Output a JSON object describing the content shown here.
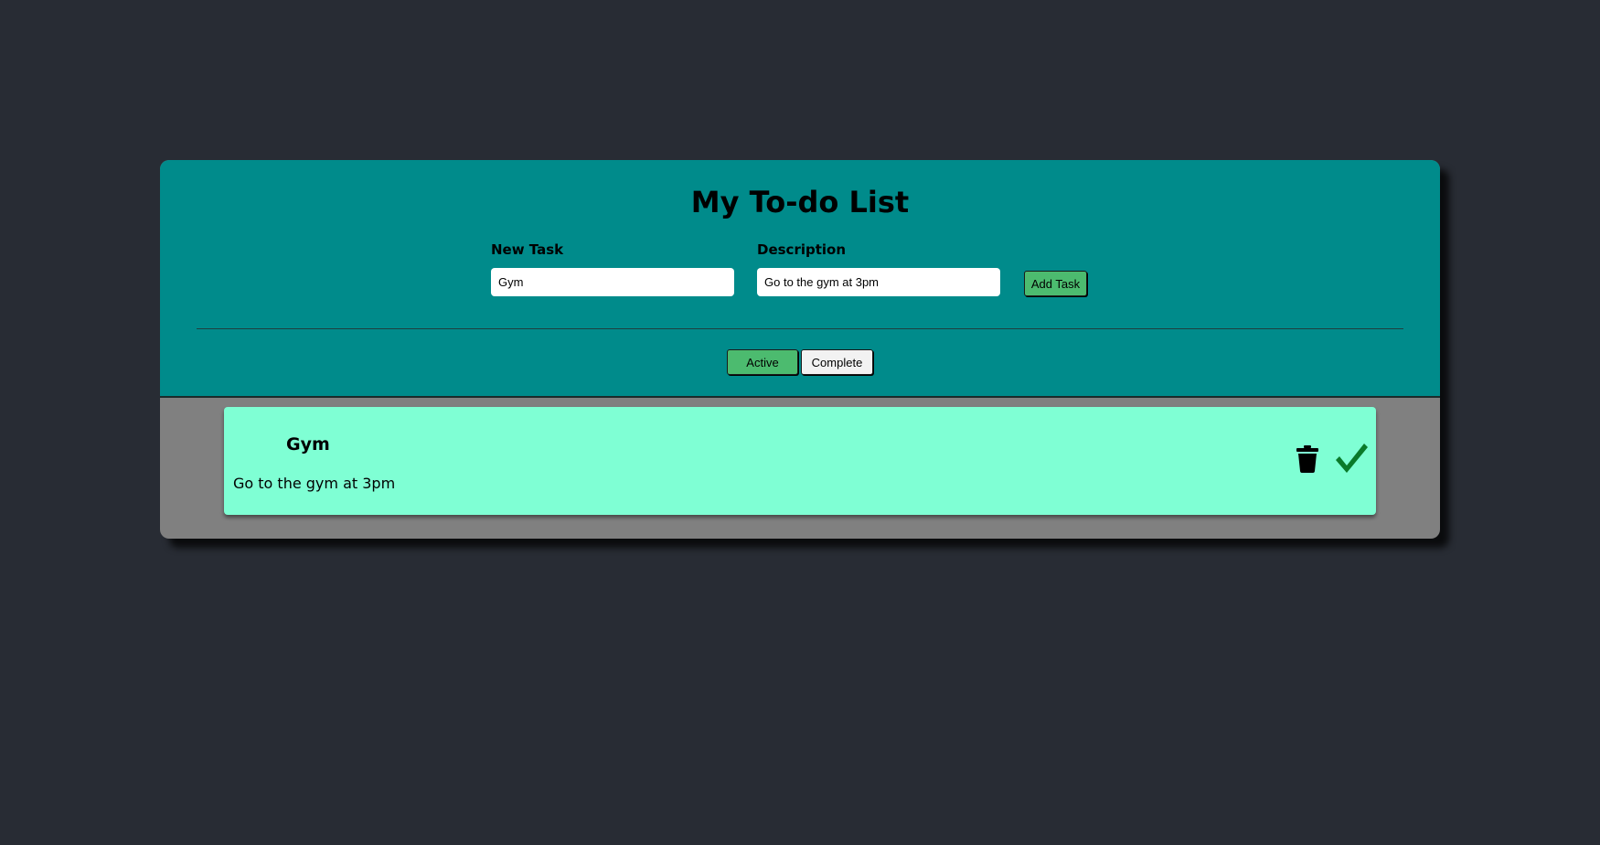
{
  "app": {
    "title": "My To-do List"
  },
  "form": {
    "task_label": "New Task",
    "task_value": "Gym",
    "description_label": "Description",
    "description_value": "Go to the gym at 3pm",
    "add_button_label": "Add Task"
  },
  "filters": {
    "active_label": "Active",
    "complete_label": "Complete",
    "selected": "Active"
  },
  "tasks": [
    {
      "title": "Gym",
      "description": "Go to the gym at 3pm",
      "actions": [
        "trash-icon",
        "check-icon"
      ]
    }
  ],
  "colors": {
    "page_background": "#282c34",
    "header_background": "#008b8b",
    "list_background": "#808080",
    "task_card": "#7fffd4",
    "accent_button": "#4cbb6f",
    "check_icon": "#0a7a2a"
  }
}
